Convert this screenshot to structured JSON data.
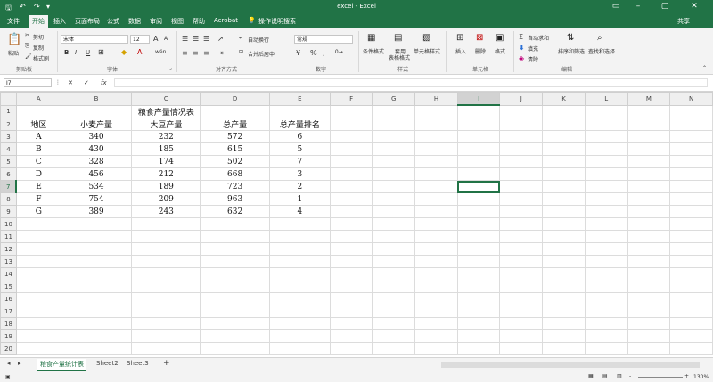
{
  "window": {
    "title": "excel  -  Excel",
    "share": "共享"
  },
  "quick_access": {
    "save_icon": "save-icon",
    "undo_icon": "undo-icon",
    "redo_icon": "redo-icon"
  },
  "menu": {
    "tabs": [
      "文件",
      "开始",
      "插入",
      "页面布局",
      "公式",
      "数据",
      "审阅",
      "视图",
      "帮助",
      "Acrobat"
    ],
    "active": "开始",
    "search_hint": "操作说明搜索"
  },
  "ribbon": {
    "clipboard": {
      "paste": "粘贴",
      "cut": "剪切",
      "copy": "复制",
      "format_painter": "格式刷",
      "label": "剪贴板"
    },
    "font": {
      "name": "宋体",
      "size": "12",
      "bold": "B",
      "italic": "I",
      "underline": "U",
      "grow": "A",
      "shrink": "A",
      "phonetic": "wén",
      "label": "字体"
    },
    "alignment": {
      "wrap": "自动换行",
      "merge": "合并后居中",
      "label": "对齐方式"
    },
    "number": {
      "format": "常规",
      "percent": "%",
      "comma": ",",
      "label": "数字"
    },
    "styles": {
      "conditional": "条件格式",
      "table_format_1": "套用",
      "table_format_2": "表格格式",
      "cell_styles": "单元格样式",
      "label": "样式"
    },
    "cells": {
      "insert": "插入",
      "delete": "删除",
      "format": "格式",
      "label": "单元格"
    },
    "editing": {
      "autosum": "自动求和",
      "fill": "填充",
      "clear": "清除",
      "sort_filter": "排序和筛选",
      "find_select": "查找和选择",
      "label": "编辑"
    }
  },
  "formula_bar": {
    "name_box": "I7",
    "fx": "fx",
    "value": ""
  },
  "sheet": {
    "columns": [
      "A",
      "B",
      "C",
      "D",
      "E",
      "F",
      "G",
      "H",
      "I",
      "J",
      "K",
      "L",
      "M",
      "N"
    ],
    "rows": [
      [
        "",
        "",
        "粮食产量情况表",
        "",
        "",
        "",
        "",
        "",
        "",
        "",
        "",
        "",
        "",
        ""
      ],
      [
        "地区",
        "小麦产量",
        "大豆产量",
        "总产量",
        "总产量排名",
        "",
        "",
        "",
        "",
        "",
        "",
        "",
        "",
        ""
      ],
      [
        "A",
        "340",
        "232",
        "572",
        "6",
        "",
        "",
        "",
        "",
        "",
        "",
        "",
        "",
        ""
      ],
      [
        "B",
        "430",
        "185",
        "615",
        "5",
        "",
        "",
        "",
        "",
        "",
        "",
        "",
        "",
        ""
      ],
      [
        "C",
        "328",
        "174",
        "502",
        "7",
        "",
        "",
        "",
        "",
        "",
        "",
        "",
        "",
        ""
      ],
      [
        "D",
        "456",
        "212",
        "668",
        "3",
        "",
        "",
        "",
        "",
        "",
        "",
        "",
        "",
        ""
      ],
      [
        "E",
        "534",
        "189",
        "723",
        "2",
        "",
        "",
        "",
        "",
        "",
        "",
        "",
        "",
        ""
      ],
      [
        "F",
        "754",
        "209",
        "963",
        "1",
        "",
        "",
        "",
        "",
        "",
        "",
        "",
        "",
        ""
      ],
      [
        "G",
        "389",
        "243",
        "632",
        "4",
        "",
        "",
        "",
        "",
        "",
        "",
        "",
        "",
        ""
      ],
      [
        "",
        "",
        "",
        "",
        "",
        "",
        "",
        "",
        "",
        "",
        "",
        "",
        "",
        ""
      ],
      [
        "",
        "",
        "",
        "",
        "",
        "",
        "",
        "",
        "",
        "",
        "",
        "",
        "",
        ""
      ],
      [
        "",
        "",
        "",
        "",
        "",
        "",
        "",
        "",
        "",
        "",
        "",
        "",
        "",
        ""
      ],
      [
        "",
        "",
        "",
        "",
        "",
        "",
        "",
        "",
        "",
        "",
        "",
        "",
        "",
        ""
      ],
      [
        "",
        "",
        "",
        "",
        "",
        "",
        "",
        "",
        "",
        "",
        "",
        "",
        "",
        ""
      ],
      [
        "",
        "",
        "",
        "",
        "",
        "",
        "",
        "",
        "",
        "",
        "",
        "",
        "",
        ""
      ],
      [
        "",
        "",
        "",
        "",
        "",
        "",
        "",
        "",
        "",
        "",
        "",
        "",
        "",
        ""
      ],
      [
        "",
        "",
        "",
        "",
        "",
        "",
        "",
        "",
        "",
        "",
        "",
        "",
        "",
        ""
      ],
      [
        "",
        "",
        "",
        "",
        "",
        "",
        "",
        "",
        "",
        "",
        "",
        "",
        "",
        ""
      ],
      [
        "",
        "",
        "",
        "",
        "",
        "",
        "",
        "",
        "",
        "",
        "",
        "",
        "",
        ""
      ],
      [
        "",
        "",
        "",
        "",
        "",
        "",
        "",
        "",
        "",
        "",
        "",
        "",
        "",
        ""
      ]
    ],
    "selected": {
      "row": 7,
      "col": "I"
    }
  },
  "sheet_tabs": {
    "tabs": [
      "粮食产量统计表",
      "Sheet2",
      "Sheet3"
    ],
    "active": "粮食产量统计表",
    "add": "+"
  },
  "status_bar": {
    "zoom": "130%",
    "minus": "-",
    "plus": "+"
  },
  "colors": {
    "accent": "#217346"
  }
}
